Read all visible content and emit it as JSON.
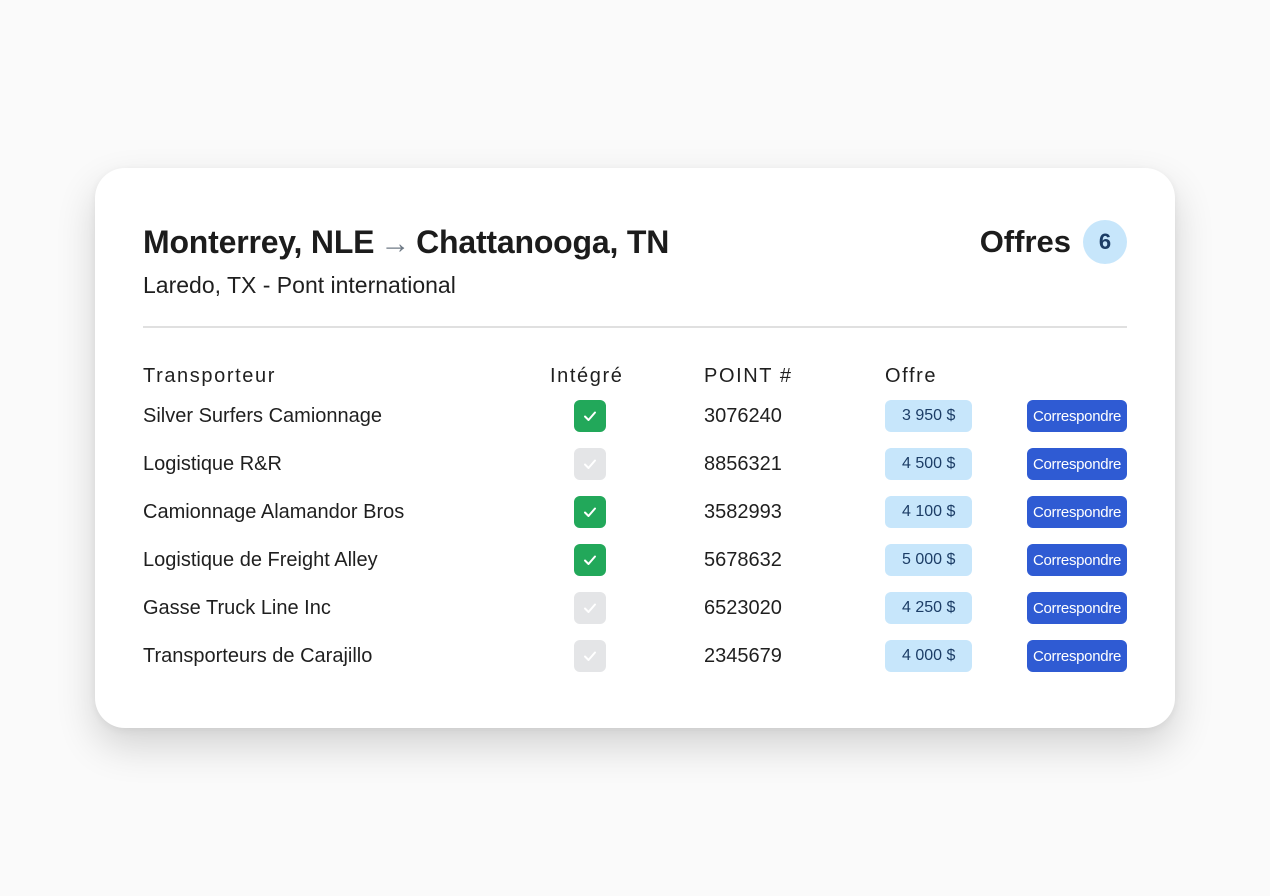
{
  "header": {
    "origin": "Monterrey, NLE",
    "arrow": "→",
    "destination": "Chattanooga, TN",
    "subtitle": "Laredo, TX - Pont international",
    "offers_label": "Offres",
    "offers_count": "6"
  },
  "table": {
    "columns": {
      "carrier": "Transporteur",
      "integrated": "Intégré",
      "point": "POINT #",
      "offer": "Offre"
    },
    "action_label": "Correspondre",
    "rows": [
      {
        "carrier": "Silver Surfers Camionnage",
        "integrated": true,
        "point": "3076240",
        "offer": "3 950 $"
      },
      {
        "carrier": "Logistique R&R",
        "integrated": false,
        "point": "8856321",
        "offer": "4 500 $"
      },
      {
        "carrier": "Camionnage Alamandor Bros",
        "integrated": true,
        "point": "3582993",
        "offer": "4 100 $"
      },
      {
        "carrier": "Logistique de Freight Alley",
        "integrated": true,
        "point": "5678632",
        "offer": "5 000 $"
      },
      {
        "carrier": "Gasse Truck Line Inc",
        "integrated": false,
        "point": "6523020",
        "offer": "4 250 $"
      },
      {
        "carrier": "Transporteurs de Carajillo",
        "integrated": false,
        "point": "2345679",
        "offer": "4 000 $"
      }
    ]
  },
  "colors": {
    "checked": "#22a85a",
    "unchecked": "#e4e5e7",
    "offer_badge": "#c7e6fb",
    "action_button": "#2f5bd3"
  }
}
